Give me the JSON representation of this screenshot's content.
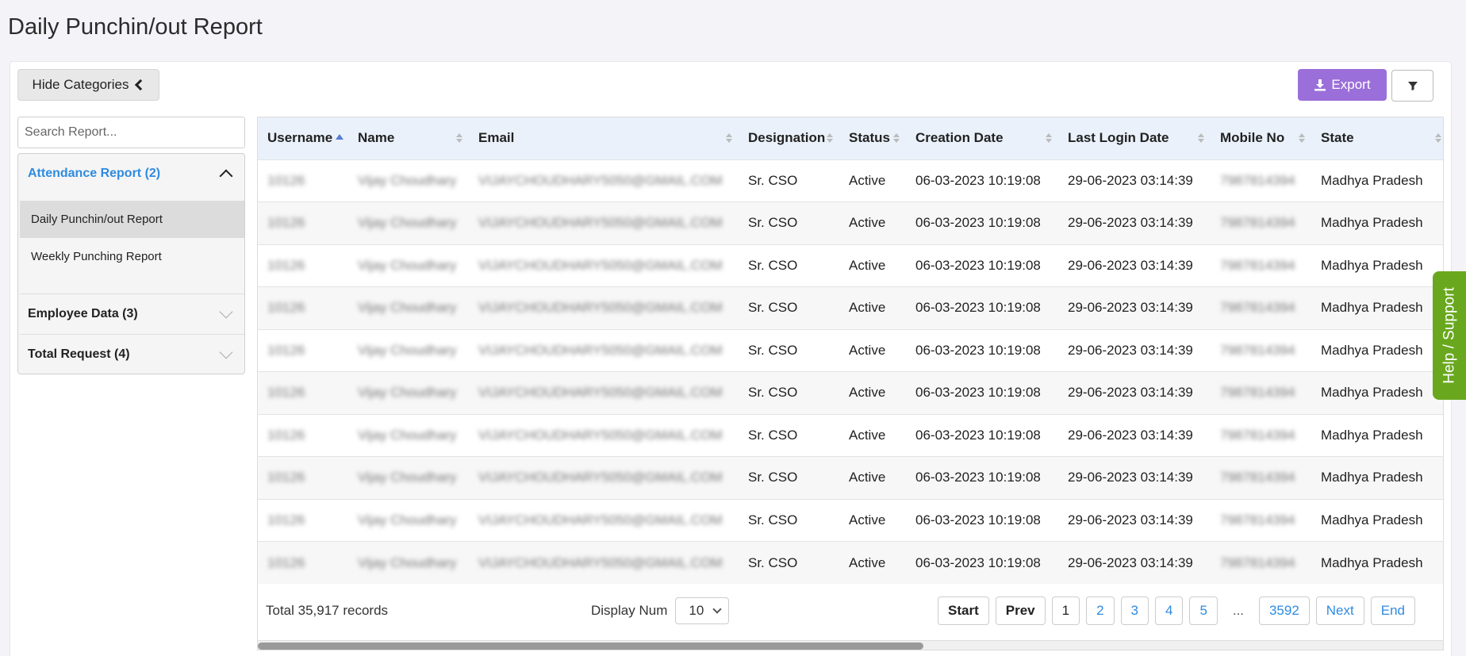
{
  "page": {
    "title": "Daily Punchin/out Report"
  },
  "toolbar": {
    "hide_categories": "Hide Categories",
    "export": "Export"
  },
  "sidebar": {
    "search_placeholder": "Search Report...",
    "categories": [
      {
        "label": "Attendance Report (2)",
        "expanded": true,
        "items": [
          {
            "label": "Daily Punchin/out Report",
            "active": true
          },
          {
            "label": "Weekly Punching Report"
          }
        ]
      },
      {
        "label": "Employee Data (3)",
        "expanded": false
      },
      {
        "label": "Total Request (4)",
        "expanded": false
      }
    ]
  },
  "table": {
    "columns": [
      "Username",
      "Name",
      "Email",
      "Designation",
      "Status",
      "Creation Date",
      "Last Login Date",
      "Mobile No",
      "State"
    ],
    "rows": [
      [
        "10126",
        "Vijay Choudhary",
        "VIJAYCHOUDHARY5050@GMAIL.COM",
        "Sr. CSO",
        "Active",
        "06-03-2023 10:19:08",
        "29-06-2023 03:14:39",
        "7987814394",
        "Madhya Pradesh"
      ],
      [
        "10126",
        "Vijay Choudhary",
        "VIJAYCHOUDHARY5050@GMAIL.COM",
        "Sr. CSO",
        "Active",
        "06-03-2023 10:19:08",
        "29-06-2023 03:14:39",
        "7987814394",
        "Madhya Pradesh"
      ],
      [
        "10126",
        "Vijay Choudhary",
        "VIJAYCHOUDHARY5050@GMAIL.COM",
        "Sr. CSO",
        "Active",
        "06-03-2023 10:19:08",
        "29-06-2023 03:14:39",
        "7987814394",
        "Madhya Pradesh"
      ],
      [
        "10126",
        "Vijay Choudhary",
        "VIJAYCHOUDHARY5050@GMAIL.COM",
        "Sr. CSO",
        "Active",
        "06-03-2023 10:19:08",
        "29-06-2023 03:14:39",
        "7987814394",
        "Madhya Pradesh"
      ],
      [
        "10126",
        "Vijay Choudhary",
        "VIJAYCHOUDHARY5050@GMAIL.COM",
        "Sr. CSO",
        "Active",
        "06-03-2023 10:19:08",
        "29-06-2023 03:14:39",
        "7987814394",
        "Madhya Pradesh"
      ],
      [
        "10126",
        "Vijay Choudhary",
        "VIJAYCHOUDHARY5050@GMAIL.COM",
        "Sr. CSO",
        "Active",
        "06-03-2023 10:19:08",
        "29-06-2023 03:14:39",
        "7987814394",
        "Madhya Pradesh"
      ],
      [
        "10126",
        "Vijay Choudhary",
        "VIJAYCHOUDHARY5050@GMAIL.COM",
        "Sr. CSO",
        "Active",
        "06-03-2023 10:19:08",
        "29-06-2023 03:14:39",
        "7987814394",
        "Madhya Pradesh"
      ],
      [
        "10126",
        "Vijay Choudhary",
        "VIJAYCHOUDHARY5050@GMAIL.COM",
        "Sr. CSO",
        "Active",
        "06-03-2023 10:19:08",
        "29-06-2023 03:14:39",
        "7987814394",
        "Madhya Pradesh"
      ],
      [
        "10126",
        "Vijay Choudhary",
        "VIJAYCHOUDHARY5050@GMAIL.COM",
        "Sr. CSO",
        "Active",
        "06-03-2023 10:19:08",
        "29-06-2023 03:14:39",
        "7987814394",
        "Madhya Pradesh"
      ],
      [
        "10126",
        "Vijay Choudhary",
        "VIJAYCHOUDHARY5050@GMAIL.COM",
        "Sr. CSO",
        "Active",
        "06-03-2023 10:19:08",
        "29-06-2023 03:14:39",
        "7987814394",
        "Madhya Pradesh"
      ]
    ],
    "blurred_columns": [
      0,
      1,
      2,
      7
    ],
    "sorted_column": "Username",
    "sort_direction": "ascending"
  },
  "footer": {
    "total": "Total 35,917 records",
    "display_label": "Display Num",
    "display_value": "10",
    "pager": {
      "start": "Start",
      "prev": "Prev",
      "pages": [
        "1",
        "2",
        "3",
        "4",
        "5"
      ],
      "ellipsis": "...",
      "last_page": "3592",
      "next": "Next",
      "end": "End",
      "current": "1"
    }
  },
  "help": {
    "label": "Help / Support",
    "color": "#69a81e"
  },
  "colors": {
    "accent": "#9b6fd9",
    "link": "#2f8be0",
    "header_bg": "#eaf1fa"
  },
  "icons": {
    "export": "download-icon",
    "filter": "filter-icon",
    "hide": "chevron-left-icon"
  }
}
